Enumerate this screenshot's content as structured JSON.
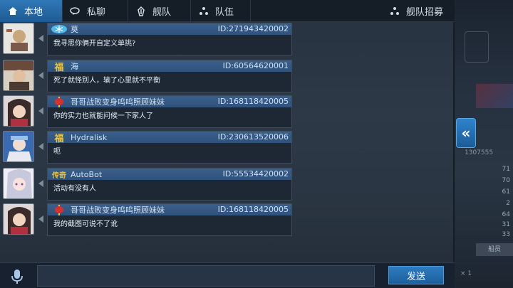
{
  "tabs": {
    "local": "本地",
    "private": "私聊",
    "fleet": "舰队",
    "team": "队伍",
    "recruit": "舰队招募"
  },
  "messages": [
    {
      "name": "莫",
      "uid": "ID:271943420002",
      "text": "我寻思你俩开自定义单挑?",
      "badge": "snowflake"
    },
    {
      "name": "海",
      "uid": "ID:60564620001",
      "text": "死了就怪别人，输了心里就不平衡",
      "badge": "福"
    },
    {
      "name": "哥哥战败变身呜呜照顾妹妹",
      "uid": "ID:168118420005",
      "text": "你的实力也就能问候一下家人了",
      "badge": "lantern"
    },
    {
      "name": "Hydralisk",
      "uid": "ID:230613520006",
      "text": "呃",
      "badge": "福"
    },
    {
      "name": "AutoBot",
      "uid": "ID:55534420002",
      "text": "活动有没有人",
      "badge": "传奇"
    },
    {
      "name": "哥哥战败变身呜呜照顾妹妹",
      "uid": "ID:168118420005",
      "text": "我的截图可说不了讹",
      "badge": "lantern"
    }
  ],
  "input": {
    "value": "",
    "placeholder": ""
  },
  "send_label": "发送",
  "background": {
    "number": "1307555",
    "values": [
      "71",
      "70",
      "61",
      "2",
      "64",
      "31",
      "33"
    ],
    "side_button": "船员",
    "times": "× 1",
    "side_label": "返回"
  },
  "colors": {
    "accent": "#2f78b8",
    "header": "#3a5f8c",
    "panel": "#263240"
  }
}
